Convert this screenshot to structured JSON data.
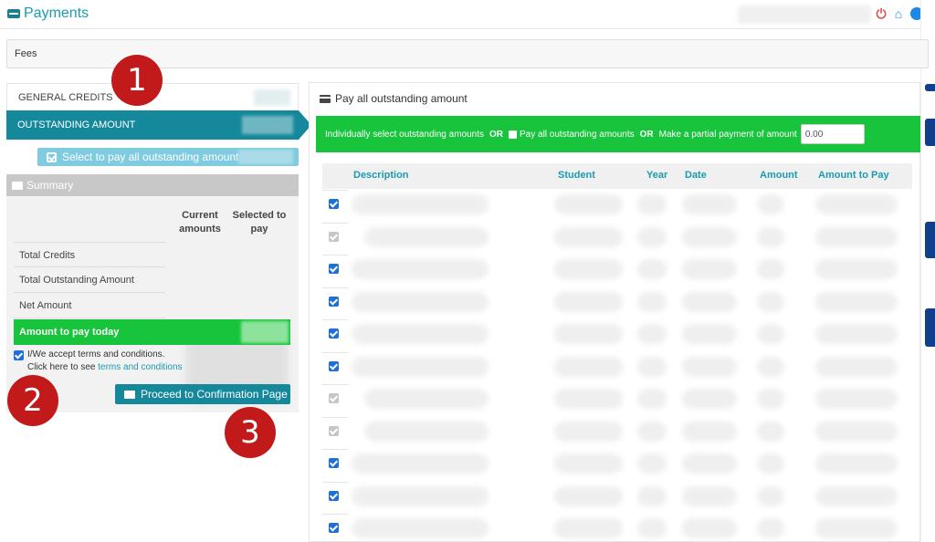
{
  "header": {
    "title": "Payments"
  },
  "fees_bar": {
    "label": "Fees"
  },
  "nav": {
    "general_credits": "GENERAL CREDITS",
    "outstanding_amount": "OUTSTANDING AMOUNT",
    "select_all_button": "Select to pay all outstanding amounts"
  },
  "summary": {
    "title": "Summary",
    "col_current": "Current amounts",
    "col_selected": "Selected to pay",
    "rows": [
      "Total Credits",
      "Total Outstanding Amount",
      "Net Amount"
    ],
    "amount_today": "Amount to pay today",
    "terms_line1": "I/We accept terms and conditions.",
    "terms_line2_prefix": "Click here to see",
    "terms_link": "terms and conditions",
    "proceed_button": "Proceed to Confirmation Page"
  },
  "steps": [
    "1",
    "2",
    "3"
  ],
  "outstanding": {
    "title": "Pay all outstanding amount",
    "opt_individual": "Individually select outstanding amounts",
    "or": "OR",
    "opt_pay_all": "Pay all outstanding amounts",
    "opt_partial": "Make a partial payment of amount",
    "partial_value": "0.00",
    "columns": {
      "description": "Description",
      "student": "Student",
      "year": "Year",
      "date": "Date",
      "amount": "Amount",
      "amount_to_pay": "Amount to Pay"
    },
    "rows_checked": [
      true,
      false,
      true,
      true,
      true,
      true,
      false,
      false,
      true,
      true,
      true
    ]
  },
  "colors": {
    "accent": "#15899b",
    "green": "#17c43b",
    "step_red": "#c21a1a",
    "checkbox_blue": "#1e6fd9"
  }
}
